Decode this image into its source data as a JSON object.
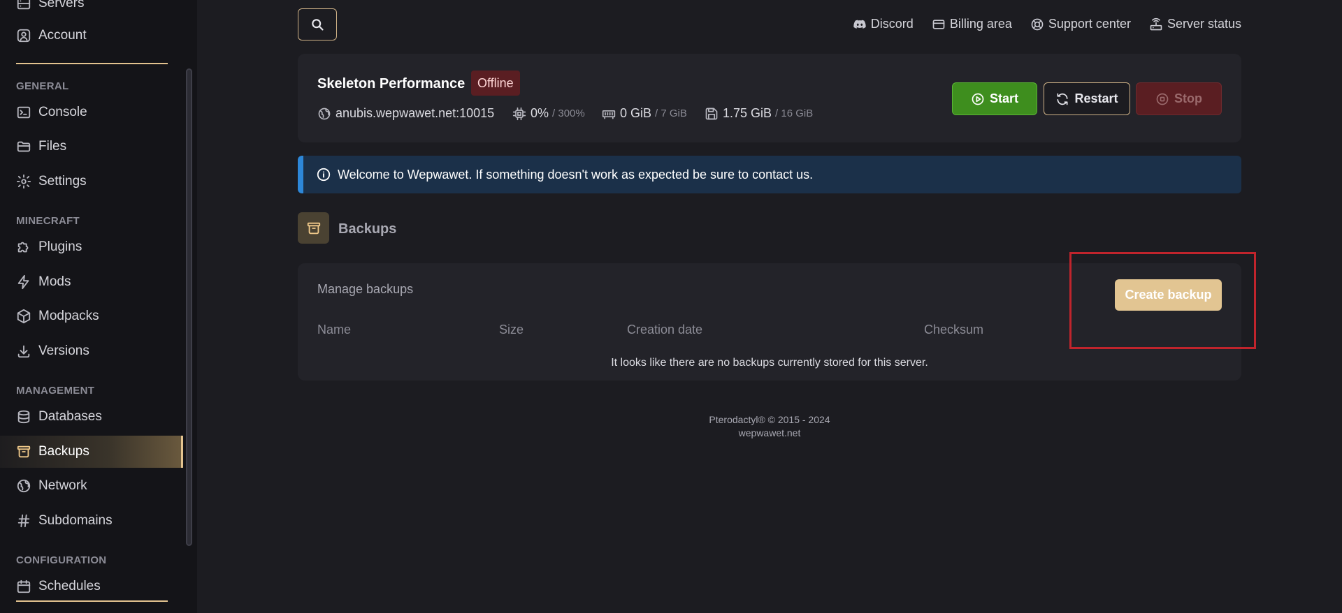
{
  "sidebar": {
    "top_items": [
      {
        "label": "Servers",
        "icon": "server-icon"
      },
      {
        "label": "Account",
        "icon": "user-circle-icon"
      }
    ],
    "sections": [
      {
        "title": "GENERAL",
        "items": [
          {
            "label": "Console",
            "icon": "terminal-icon"
          },
          {
            "label": "Files",
            "icon": "folder-icon"
          },
          {
            "label": "Settings",
            "icon": "gear-icon"
          }
        ]
      },
      {
        "title": "MINECRAFT",
        "items": [
          {
            "label": "Plugins",
            "icon": "puzzle-icon"
          },
          {
            "label": "Mods",
            "icon": "bolt-icon"
          },
          {
            "label": "Modpacks",
            "icon": "cube-icon"
          },
          {
            "label": "Versions",
            "icon": "download-icon"
          }
        ]
      },
      {
        "title": "MANAGEMENT",
        "items": [
          {
            "label": "Databases",
            "icon": "database-icon"
          },
          {
            "label": "Backups",
            "icon": "archive-icon",
            "active": true
          },
          {
            "label": "Network",
            "icon": "globe-icon"
          },
          {
            "label": "Subdomains",
            "icon": "hash-icon"
          }
        ]
      },
      {
        "title": "CONFIGURATION",
        "items": [
          {
            "label": "Schedules",
            "icon": "calendar-icon"
          }
        ]
      }
    ]
  },
  "topbar": {
    "search_icon": "search-icon",
    "links": [
      {
        "label": "Discord",
        "icon": "discord-icon"
      },
      {
        "label": "Billing area",
        "icon": "credit-card-icon"
      },
      {
        "label": "Support center",
        "icon": "lifebuoy-icon"
      },
      {
        "label": "Server status",
        "icon": "router-icon"
      }
    ]
  },
  "server": {
    "name": "Skeleton Performance",
    "status": "Offline",
    "address": "anubis.wepwawet.net:10015",
    "cpu": {
      "value": "0%",
      "limit": "/ 300%"
    },
    "memory": {
      "value": "0 GiB",
      "limit": "/ 7 GiB"
    },
    "disk": {
      "value": "1.75 GiB",
      "limit": "/ 16 GiB"
    },
    "buttons": {
      "start": "Start",
      "restart": "Restart",
      "stop": "Stop"
    }
  },
  "alert": {
    "text": "Welcome to Wepwawet. If something doesn't work as expected be sure to contact us."
  },
  "page": {
    "title": "Backups",
    "icon": "archive-icon"
  },
  "backups": {
    "card_title": "Manage backups",
    "create_button": "Create backup",
    "columns": [
      "Name",
      "Size",
      "Creation date",
      "Checksum"
    ],
    "empty_message": "It looks like there are no backups currently stored for this server."
  },
  "footer": {
    "line1": "Pterodactyl® © 2015 - 2024",
    "line2": "wepwawet.net"
  },
  "colors": {
    "accent": "#e2c592",
    "background": "#1c1c21",
    "sidebar": "#141418",
    "card": "#232329",
    "start": "#3e8e1e",
    "stop": "#5a1e22",
    "alert": "#1b3049",
    "highlight": "#c0242c"
  }
}
